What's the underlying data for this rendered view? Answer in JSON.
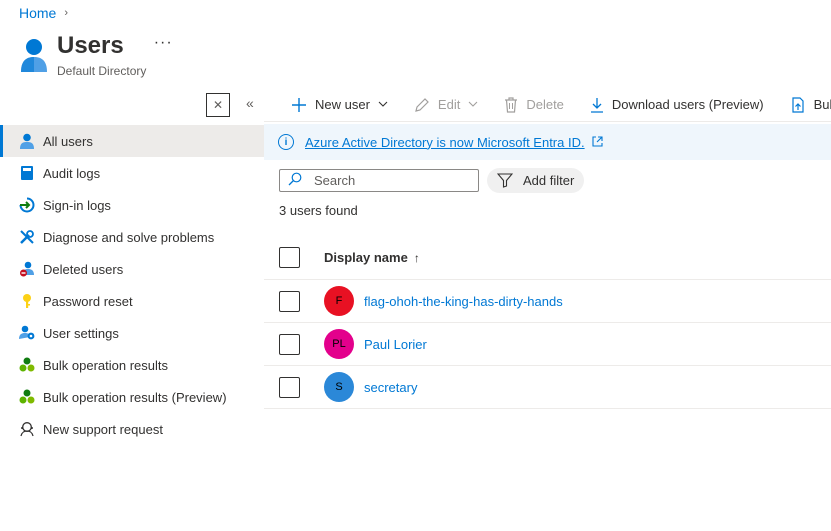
{
  "breadcrumb": {
    "home": "Home",
    "separator": "›"
  },
  "header": {
    "title": "Users",
    "subtitle": "Default Directory",
    "more": "···"
  },
  "sidebar_controls": {
    "close": "✕",
    "collapse": "«"
  },
  "sidebar": {
    "items": [
      {
        "label": "All users",
        "icon": "user-icon",
        "active": true
      },
      {
        "label": "Audit logs",
        "icon": "book-icon"
      },
      {
        "label": "Sign-in logs",
        "icon": "sign-in-icon"
      },
      {
        "label": "Diagnose and solve problems",
        "icon": "wrench-icon"
      },
      {
        "label": "Deleted users",
        "icon": "deleted-user-icon"
      },
      {
        "label": "Password reset",
        "icon": "key-icon"
      },
      {
        "label": "User settings",
        "icon": "user-settings-icon"
      },
      {
        "label": "Bulk operation results",
        "icon": "bulk-icon"
      },
      {
        "label": "Bulk operation results (Preview)",
        "icon": "bulk-icon"
      },
      {
        "label": "New support request",
        "icon": "support-icon"
      }
    ]
  },
  "toolbar": {
    "new_user": "New user",
    "edit": "Edit",
    "delete": "Delete",
    "download": "Download users (Preview)",
    "bulk": "Bulk operations"
  },
  "banner": {
    "text": "Azure Active Directory is now Microsoft Entra ID."
  },
  "search": {
    "placeholder": "Search"
  },
  "filter": {
    "label": "Add filter"
  },
  "results": {
    "count_text": "3 users found"
  },
  "table": {
    "header": {
      "display_name": "Display name",
      "sort_indicator": "↑"
    },
    "rows": [
      {
        "initials": "F",
        "name": "flag-ohoh-the-king-has-dirty-hands",
        "color": "#e81123"
      },
      {
        "initials": "PL",
        "name": "Paul Lorier",
        "color": "#e3008c"
      },
      {
        "initials": "S",
        "name": "secretary",
        "color": "#2b88d8"
      }
    ]
  },
  "colors": {
    "accent": "#0078d4",
    "active_nav_bg": "#edebe9",
    "banner_bg": "#eff6fc"
  }
}
